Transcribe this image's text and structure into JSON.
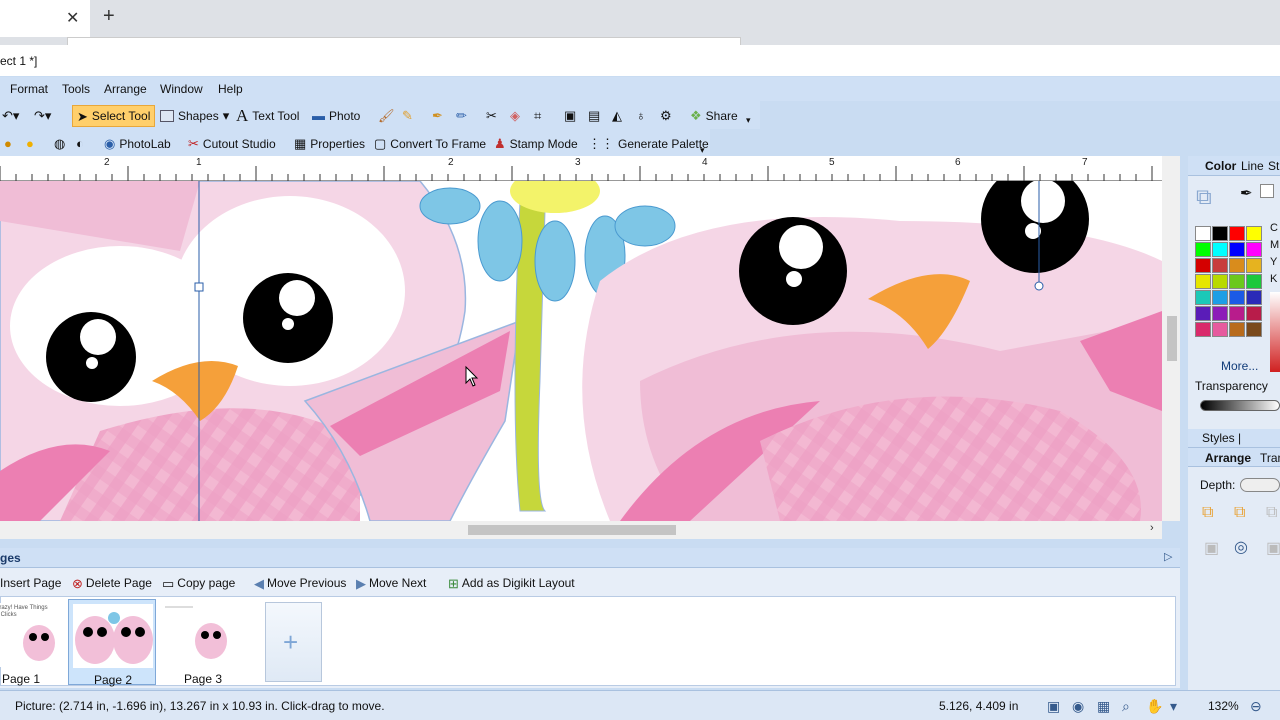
{
  "browser": {
    "close_glyph": "✕",
    "new_tab_glyph": "+"
  },
  "window": {
    "title": "ect 1 *]"
  },
  "menu": [
    "Format",
    "Tools",
    "Arrange",
    "Window",
    "Help"
  ],
  "toolbar1": {
    "select_tool": "Select Tool",
    "shapes": "Shapes",
    "text_tool": "Text Tool",
    "photo": "Photo",
    "share": "Share"
  },
  "toolbar2": {
    "photolab": "PhotoLab",
    "cutout_studio": "Cutout Studio",
    "properties": "Properties",
    "convert_to_frame": "Convert To Frame",
    "stamp_mode": "Stamp Mode",
    "generate_palette": "Generate Palette"
  },
  "ruler": {
    "labels": [
      "2",
      "1",
      "2",
      "3",
      "4",
      "5",
      "6",
      "7"
    ]
  },
  "pages_panel": {
    "title": "ges",
    "toolbar": {
      "insert": "Insert Page",
      "delete": "Delete Page",
      "copy": "Copy page",
      "move_previous": "Move Previous",
      "move_next": "Move Next",
      "add_digikit": "Add as Digikit Layout"
    },
    "thumbnails": [
      {
        "label": "Page 1",
        "thumb_text": "Fab Crazy! Have Things Super Clicks"
      },
      {
        "label": "Page 2",
        "selected": true
      },
      {
        "label": "Page 3"
      }
    ]
  },
  "status": {
    "text": "Picture: (2.714 in, -1.696 in), 13.267 in x 10.93 in. Click-drag to move.",
    "coords": "5.126,  4.409 in",
    "zoom": "132%"
  },
  "right_panel": {
    "color_tabs": [
      "Color",
      "Line",
      "St"
    ],
    "cmyk_labels": [
      "C",
      "M",
      "Y",
      "K"
    ],
    "more": "More...",
    "transparency": "Transparency",
    "styles_tabs": "Styles | Brushes",
    "arrange_tab": "Arrange",
    "tran_tab": "Tran",
    "depth": "Depth:",
    "palette_colors": [
      "#ffffff",
      "#000000",
      "#ff0000",
      "#ffff00",
      "#00ff00",
      "#00ffff",
      "#0000ff",
      "#ff00ff",
      "#d40000",
      "#c83c3c",
      "#d98c1c",
      "#e6b31f",
      "#e6e600",
      "#b8d900",
      "#6bc81c",
      "#1cc83c",
      "#1cc8b8",
      "#1c9ee6",
      "#1c5ae6",
      "#2a2ab8",
      "#5a1cb8",
      "#8c1cb8",
      "#b81c8c",
      "#b81c4a",
      "#d92a6b",
      "#e65a9e",
      "#b86b1c",
      "#7a4a1c"
    ]
  },
  "colors": {
    "accent": "#ffcf6b",
    "panel": "#cfe0f5",
    "owl_pink": "#f0c6dc",
    "owl_beak": "#f5a03a",
    "flower": "#7ec6e6"
  }
}
